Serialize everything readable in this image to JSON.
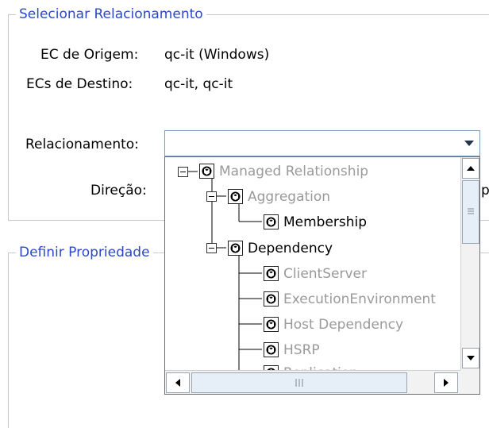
{
  "select_section": {
    "legend": "Selecionar Relacionamento",
    "source_label": "EC de Origem:",
    "source_value": "qc-it (Windows)",
    "dest_label": "ECs de Destino:",
    "dest_value": "qc-it, qc-it",
    "relationship_label": "Relacionamento:",
    "relationship_value": "",
    "direction_label": "Direção:",
    "direction_value_partial": "p"
  },
  "properties_section": {
    "legend": "Definir Propriedade"
  },
  "tree": {
    "nodes": [
      {
        "label": "Managed Relationship",
        "enabled": false
      },
      {
        "label": "Aggregation",
        "enabled": false
      },
      {
        "label": "Membership",
        "enabled": true
      },
      {
        "label": "Dependency",
        "enabled": true
      },
      {
        "label": "ClientServer",
        "enabled": false
      },
      {
        "label": "ExecutionEnvironment",
        "enabled": false
      },
      {
        "label": "Host Dependency",
        "enabled": false
      },
      {
        "label": "HSRP",
        "enabled": false
      },
      {
        "label": "Replication",
        "enabled": false
      }
    ]
  },
  "colors": {
    "legend": "#2a49c9",
    "disabled_text": "#9a9a9a",
    "border": "#c9c9c9"
  }
}
